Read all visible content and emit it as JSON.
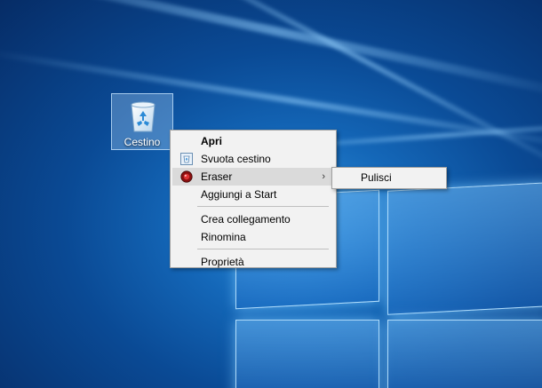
{
  "desktop": {
    "icons": [
      {
        "label": "Cestino",
        "icon": "recycle-bin-icon"
      }
    ]
  },
  "context_menu": {
    "items": [
      {
        "label": "Apri",
        "bold": true
      },
      {
        "label": "Svuota cestino",
        "icon": "empty-recycle-bin-icon"
      },
      {
        "label": "Eraser",
        "icon": "eraser-icon",
        "has_submenu": true,
        "highlighted": true
      },
      {
        "label": "Aggiungi a Start"
      },
      {
        "label": "Crea collegamento"
      },
      {
        "label": "Rinomina"
      },
      {
        "label": "Proprietà"
      }
    ],
    "submenu_arrow": "›"
  },
  "eraser_submenu": {
    "items": [
      {
        "label": "Pulisci"
      }
    ]
  },
  "colors": {
    "menu_background": "#f2f2f2",
    "menu_highlight": "#dadada",
    "desktop_accent": "#1467b8"
  }
}
